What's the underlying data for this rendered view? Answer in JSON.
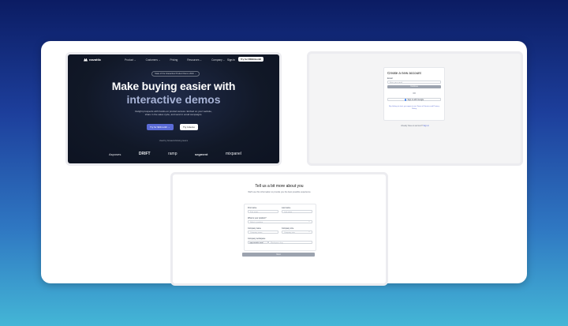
{
  "landing": {
    "brand": "navattic",
    "nav": [
      "Product",
      "Customers",
      "Pricing",
      "Resources",
      "Company"
    ],
    "sign_in": "Sign in",
    "try_cta": "Try for FREE/month",
    "pill": "State of the Interactive Product Demo 2024 →",
    "headline_1": "Make buying easier with",
    "headline_2": "interactive demos",
    "subtext": "Delight prospects with hands-on product access. Embed on your website, share in the sales cycle, and send in email campaigns.",
    "primary_cta": "Try for $0/month →",
    "secondary_cta": "Try it demo",
    "trusted": "Used by forward-thinking teams",
    "customers": [
      "Asposes",
      "DRIFT",
      "ramp",
      "segment",
      "mixpanel"
    ]
  },
  "signup": {
    "title": "Create a new account",
    "email_label": "Email",
    "email_placeholder": "Enter your email",
    "continue": "Continue",
    "or": "OR",
    "google": "Sign in with Google",
    "terms": "By clicking to start, you agree to our Terms of Service and Privacy Policy",
    "already": "Already have an account?",
    "sign_in": "Sign in"
  },
  "about": {
    "title": "Tell us a bit more about you",
    "subtitle": "We'll use this information to provide you the best possible experience",
    "first_name_label": "First name",
    "first_name_placeholder": "First name",
    "last_name_label": "Last name",
    "last_name_placeholder": "Last name",
    "position_label": "What is your position?",
    "position_placeholder": "Select a position",
    "company_name_label": "Company name",
    "company_name_placeholder": "Company name",
    "company_size_label": "Company size",
    "company_size_placeholder": "Company size",
    "workspace_label": "Company workspace",
    "workspace_prefix": "app.navattic.com/",
    "workspace_placeholder": "Workspace slug",
    "next": "Next"
  }
}
